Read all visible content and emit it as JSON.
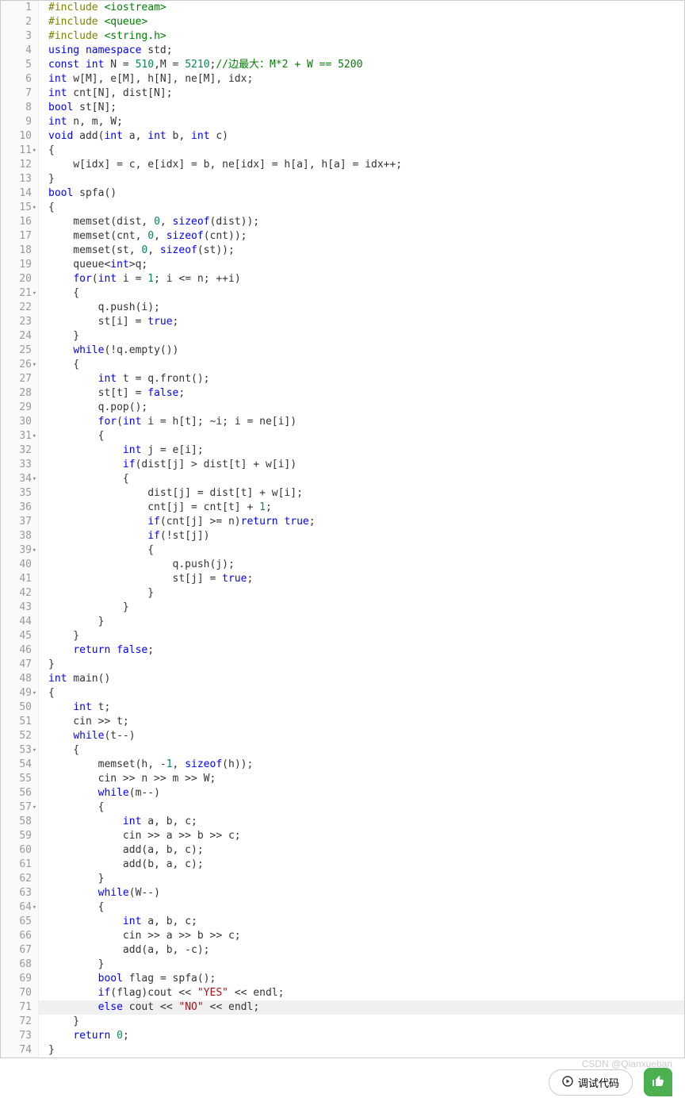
{
  "lines": [
    {
      "n": 1,
      "parts": [
        {
          "c": "pp",
          "t": "#include "
        },
        {
          "c": "hdr",
          "t": "<iostream>"
        }
      ]
    },
    {
      "n": 2,
      "parts": [
        {
          "c": "pp",
          "t": "#include "
        },
        {
          "c": "hdr",
          "t": "<queue>"
        }
      ]
    },
    {
      "n": 3,
      "parts": [
        {
          "c": "pp",
          "t": "#include "
        },
        {
          "c": "hdr",
          "t": "<string.h>"
        }
      ]
    },
    {
      "n": 4,
      "parts": [
        {
          "c": "kw",
          "t": "using"
        },
        {
          "t": " "
        },
        {
          "c": "kw",
          "t": "namespace"
        },
        {
          "t": " std;"
        }
      ]
    },
    {
      "n": 5,
      "parts": [
        {
          "c": "kw",
          "t": "const"
        },
        {
          "t": " "
        },
        {
          "c": "kw",
          "t": "int"
        },
        {
          "t": " N = "
        },
        {
          "c": "num",
          "t": "510"
        },
        {
          "t": ",M = "
        },
        {
          "c": "num",
          "t": "5210"
        },
        {
          "t": ";"
        },
        {
          "c": "cmt",
          "t": "//边最大：M*2 + W == 5200"
        }
      ]
    },
    {
      "n": 6,
      "parts": [
        {
          "c": "kw",
          "t": "int"
        },
        {
          "t": " w[M], e[M], h[N], ne[M], idx;"
        }
      ]
    },
    {
      "n": 7,
      "parts": [
        {
          "c": "kw",
          "t": "int"
        },
        {
          "t": " cnt[N], dist[N];"
        }
      ]
    },
    {
      "n": 8,
      "parts": [
        {
          "c": "kw",
          "t": "bool"
        },
        {
          "t": " st[N];"
        }
      ]
    },
    {
      "n": 9,
      "parts": [
        {
          "c": "kw",
          "t": "int"
        },
        {
          "t": " n, m, W;"
        }
      ]
    },
    {
      "n": 10,
      "parts": [
        {
          "c": "kw",
          "t": "void"
        },
        {
          "t": " add("
        },
        {
          "c": "kw",
          "t": "int"
        },
        {
          "t": " a, "
        },
        {
          "c": "kw",
          "t": "int"
        },
        {
          "t": " b, "
        },
        {
          "c": "kw",
          "t": "int"
        },
        {
          "t": " c)"
        }
      ]
    },
    {
      "n": 11,
      "fold": true,
      "parts": [
        {
          "t": "{"
        }
      ]
    },
    {
      "n": 12,
      "parts": [
        {
          "t": "    w[idx] = c, e[idx] = b, ne[idx] = h[a], h[a] = idx++;"
        }
      ]
    },
    {
      "n": 13,
      "parts": [
        {
          "t": "}"
        }
      ]
    },
    {
      "n": 14,
      "parts": [
        {
          "c": "kw",
          "t": "bool"
        },
        {
          "t": " spfa()"
        }
      ]
    },
    {
      "n": 15,
      "fold": true,
      "parts": [
        {
          "t": "{"
        }
      ]
    },
    {
      "n": 16,
      "parts": [
        {
          "t": "    memset(dist, "
        },
        {
          "c": "num",
          "t": "0"
        },
        {
          "t": ", "
        },
        {
          "c": "kw",
          "t": "sizeof"
        },
        {
          "t": "(dist));"
        }
      ]
    },
    {
      "n": 17,
      "parts": [
        {
          "t": "    memset(cnt, "
        },
        {
          "c": "num",
          "t": "0"
        },
        {
          "t": ", "
        },
        {
          "c": "kw",
          "t": "sizeof"
        },
        {
          "t": "(cnt));"
        }
      ]
    },
    {
      "n": 18,
      "parts": [
        {
          "t": "    memset(st, "
        },
        {
          "c": "num",
          "t": "0"
        },
        {
          "t": ", "
        },
        {
          "c": "kw",
          "t": "sizeof"
        },
        {
          "t": "(st));"
        }
      ]
    },
    {
      "n": 19,
      "parts": [
        {
          "t": "    queue<"
        },
        {
          "c": "kw",
          "t": "int"
        },
        {
          "t": ">q;"
        }
      ]
    },
    {
      "n": 20,
      "parts": [
        {
          "t": "    "
        },
        {
          "c": "kw",
          "t": "for"
        },
        {
          "t": "("
        },
        {
          "c": "kw",
          "t": "int"
        },
        {
          "t": " i = "
        },
        {
          "c": "num",
          "t": "1"
        },
        {
          "t": "; i <= n; ++i)"
        }
      ]
    },
    {
      "n": 21,
      "fold": true,
      "parts": [
        {
          "t": "    {"
        }
      ]
    },
    {
      "n": 22,
      "parts": [
        {
          "t": "        q.push(i);"
        }
      ]
    },
    {
      "n": 23,
      "parts": [
        {
          "t": "        st[i] = "
        },
        {
          "c": "kw",
          "t": "true"
        },
        {
          "t": ";"
        }
      ]
    },
    {
      "n": 24,
      "parts": [
        {
          "t": "    }"
        }
      ]
    },
    {
      "n": 25,
      "parts": [
        {
          "t": "    "
        },
        {
          "c": "kw",
          "t": "while"
        },
        {
          "t": "(!q.empty())"
        }
      ]
    },
    {
      "n": 26,
      "fold": true,
      "parts": [
        {
          "t": "    {"
        }
      ]
    },
    {
      "n": 27,
      "parts": [
        {
          "t": "        "
        },
        {
          "c": "kw",
          "t": "int"
        },
        {
          "t": " t = q.front();"
        }
      ]
    },
    {
      "n": 28,
      "parts": [
        {
          "t": "        st[t] = "
        },
        {
          "c": "kw",
          "t": "false"
        },
        {
          "t": ";"
        }
      ]
    },
    {
      "n": 29,
      "parts": [
        {
          "t": "        q.pop();"
        }
      ]
    },
    {
      "n": 30,
      "parts": [
        {
          "t": "        "
        },
        {
          "c": "kw",
          "t": "for"
        },
        {
          "t": "("
        },
        {
          "c": "kw",
          "t": "int"
        },
        {
          "t": " i = h[t]; ~i; i = ne[i])"
        }
      ]
    },
    {
      "n": 31,
      "fold": true,
      "parts": [
        {
          "t": "        {"
        }
      ]
    },
    {
      "n": 32,
      "parts": [
        {
          "t": "            "
        },
        {
          "c": "kw",
          "t": "int"
        },
        {
          "t": " j = e[i];"
        }
      ]
    },
    {
      "n": 33,
      "parts": [
        {
          "t": "            "
        },
        {
          "c": "kw",
          "t": "if"
        },
        {
          "t": "(dist[j] > dist[t] + w[i])"
        }
      ]
    },
    {
      "n": 34,
      "fold": true,
      "parts": [
        {
          "t": "            {"
        }
      ]
    },
    {
      "n": 35,
      "parts": [
        {
          "t": "                dist[j] = dist[t] + w[i];"
        }
      ]
    },
    {
      "n": 36,
      "parts": [
        {
          "t": "                cnt[j] = cnt[t] + "
        },
        {
          "c": "num",
          "t": "1"
        },
        {
          "t": ";"
        }
      ]
    },
    {
      "n": 37,
      "parts": [
        {
          "t": "                "
        },
        {
          "c": "kw",
          "t": "if"
        },
        {
          "t": "(cnt[j] >= n)"
        },
        {
          "c": "kw",
          "t": "return"
        },
        {
          "t": " "
        },
        {
          "c": "kw",
          "t": "true"
        },
        {
          "t": ";"
        }
      ]
    },
    {
      "n": 38,
      "parts": [
        {
          "t": "                "
        },
        {
          "c": "kw",
          "t": "if"
        },
        {
          "t": "(!st[j])"
        }
      ]
    },
    {
      "n": 39,
      "fold": true,
      "parts": [
        {
          "t": "                {"
        }
      ]
    },
    {
      "n": 40,
      "parts": [
        {
          "t": "                    q.push(j);"
        }
      ]
    },
    {
      "n": 41,
      "parts": [
        {
          "t": "                    st[j] = "
        },
        {
          "c": "kw",
          "t": "true"
        },
        {
          "t": ";"
        }
      ]
    },
    {
      "n": 42,
      "parts": [
        {
          "t": "                }"
        }
      ]
    },
    {
      "n": 43,
      "parts": [
        {
          "t": "            }"
        }
      ]
    },
    {
      "n": 44,
      "parts": [
        {
          "t": "        }"
        }
      ]
    },
    {
      "n": 45,
      "parts": [
        {
          "t": "    }"
        }
      ]
    },
    {
      "n": 46,
      "parts": [
        {
          "t": "    "
        },
        {
          "c": "kw",
          "t": "return"
        },
        {
          "t": " "
        },
        {
          "c": "kw",
          "t": "false"
        },
        {
          "t": ";"
        }
      ]
    },
    {
      "n": 47,
      "parts": [
        {
          "t": "}"
        }
      ]
    },
    {
      "n": 48,
      "parts": [
        {
          "c": "kw",
          "t": "int"
        },
        {
          "t": " main()"
        }
      ]
    },
    {
      "n": 49,
      "fold": true,
      "parts": [
        {
          "t": "{"
        }
      ]
    },
    {
      "n": 50,
      "parts": [
        {
          "t": "    "
        },
        {
          "c": "kw",
          "t": "int"
        },
        {
          "t": " t;"
        }
      ]
    },
    {
      "n": 51,
      "parts": [
        {
          "t": "    cin >> t;"
        }
      ]
    },
    {
      "n": 52,
      "parts": [
        {
          "t": "    "
        },
        {
          "c": "kw",
          "t": "while"
        },
        {
          "t": "(t--)"
        }
      ]
    },
    {
      "n": 53,
      "fold": true,
      "parts": [
        {
          "t": "    {"
        }
      ]
    },
    {
      "n": 54,
      "parts": [
        {
          "t": "        memset(h, -"
        },
        {
          "c": "num",
          "t": "1"
        },
        {
          "t": ", "
        },
        {
          "c": "kw",
          "t": "sizeof"
        },
        {
          "t": "(h));"
        }
      ]
    },
    {
      "n": 55,
      "parts": [
        {
          "t": "        cin >> n >> m >> W;"
        }
      ]
    },
    {
      "n": 56,
      "parts": [
        {
          "t": "        "
        },
        {
          "c": "kw",
          "t": "while"
        },
        {
          "t": "(m--)"
        }
      ]
    },
    {
      "n": 57,
      "fold": true,
      "parts": [
        {
          "t": "        {"
        }
      ]
    },
    {
      "n": 58,
      "parts": [
        {
          "t": "            "
        },
        {
          "c": "kw",
          "t": "int"
        },
        {
          "t": " a, b, c;"
        }
      ]
    },
    {
      "n": 59,
      "parts": [
        {
          "t": "            cin >> a >> b >> c;"
        }
      ]
    },
    {
      "n": 60,
      "parts": [
        {
          "t": "            add(a, b, c);"
        }
      ]
    },
    {
      "n": 61,
      "parts": [
        {
          "t": "            add(b, a, c);"
        }
      ]
    },
    {
      "n": 62,
      "parts": [
        {
          "t": "        }"
        }
      ]
    },
    {
      "n": 63,
      "parts": [
        {
          "t": "        "
        },
        {
          "c": "kw",
          "t": "while"
        },
        {
          "t": "(W--)"
        }
      ]
    },
    {
      "n": 64,
      "fold": true,
      "parts": [
        {
          "t": "        {"
        }
      ]
    },
    {
      "n": 65,
      "parts": [
        {
          "t": "            "
        },
        {
          "c": "kw",
          "t": "int"
        },
        {
          "t": " a, b, c;"
        }
      ]
    },
    {
      "n": 66,
      "parts": [
        {
          "t": "            cin >> a >> b >> c;"
        }
      ]
    },
    {
      "n": 67,
      "parts": [
        {
          "t": "            add(a, b, -c);"
        }
      ]
    },
    {
      "n": 68,
      "parts": [
        {
          "t": "        }"
        }
      ]
    },
    {
      "n": 69,
      "parts": [
        {
          "t": "        "
        },
        {
          "c": "kw",
          "t": "bool"
        },
        {
          "t": " flag = spfa();"
        }
      ]
    },
    {
      "n": 70,
      "parts": [
        {
          "t": "        "
        },
        {
          "c": "kw",
          "t": "if"
        },
        {
          "t": "(flag)cout << "
        },
        {
          "c": "str",
          "t": "\"YES\""
        },
        {
          "t": " << endl;"
        }
      ]
    },
    {
      "n": 71,
      "hl": true,
      "parts": [
        {
          "t": "        "
        },
        {
          "c": "kw",
          "t": "else"
        },
        {
          "t": " cout << "
        },
        {
          "c": "str",
          "t": "\"NO\""
        },
        {
          "t": " << endl;"
        }
      ]
    },
    {
      "n": 72,
      "parts": [
        {
          "t": "    }"
        }
      ]
    },
    {
      "n": 73,
      "parts": [
        {
          "t": "    "
        },
        {
          "c": "kw",
          "t": "return"
        },
        {
          "t": " "
        },
        {
          "c": "num",
          "t": "0"
        },
        {
          "t": ";"
        }
      ]
    },
    {
      "n": 74,
      "parts": [
        {
          "t": "}"
        }
      ]
    }
  ],
  "debug_label": "调试代码",
  "watermark": "CSDN @Qianxueban"
}
